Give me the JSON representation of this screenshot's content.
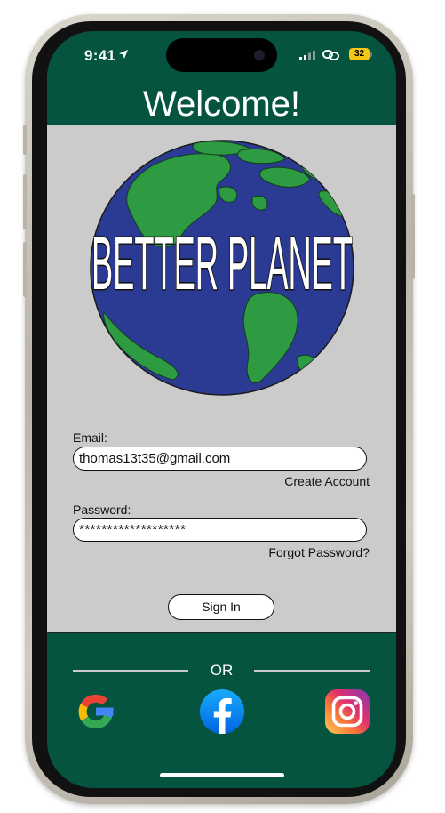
{
  "status_bar": {
    "time": "9:41",
    "battery": "32"
  },
  "header": {
    "title": "Welcome!"
  },
  "logo": {
    "text": "BETTER PLANET"
  },
  "login": {
    "email_label": "Email:",
    "email_value": "thomas13t35@gmail.com",
    "create_account": "Create Account",
    "password_label": "Password:",
    "password_value": "*******************",
    "forgot_password": "Forgot Password?",
    "sign_in": "Sign In"
  },
  "divider": {
    "text": "OR"
  },
  "social": [
    {
      "icon": "google-icon"
    },
    {
      "icon": "facebook-icon"
    },
    {
      "icon": "instagram-icon"
    }
  ],
  "colors": {
    "header_bg": "#045440",
    "content_bg": "#cbcbcb",
    "ocean": "#2b3a92",
    "land": "#2e9a42",
    "battery": "#f3c617"
  }
}
